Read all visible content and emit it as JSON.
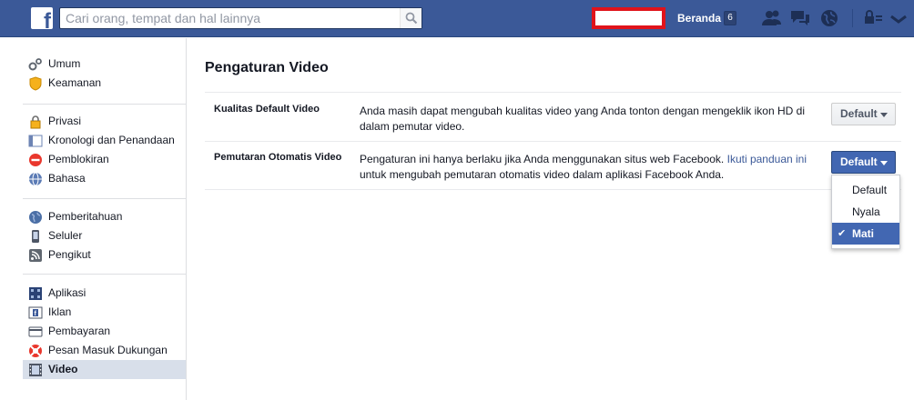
{
  "topbar": {
    "logo": "f",
    "search_placeholder": "Cari orang, tempat dan hal lainnya",
    "home_label": "Beranda",
    "home_count": "6"
  },
  "sidebar": {
    "groups": [
      [
        {
          "label": "Umum",
          "icon": "gears-icon"
        },
        {
          "label": "Keamanan",
          "icon": "shield-icon"
        }
      ],
      [
        {
          "label": "Privasi",
          "icon": "lock-icon"
        },
        {
          "label": "Kronologi dan Penandaan",
          "icon": "timeline-icon"
        },
        {
          "label": "Pemblokiran",
          "icon": "block-icon"
        },
        {
          "label": "Bahasa",
          "icon": "globe-icon"
        }
      ],
      [
        {
          "label": "Pemberitahuan",
          "icon": "globe-icon"
        },
        {
          "label": "Seluler",
          "icon": "phone-icon"
        },
        {
          "label": "Pengikut",
          "icon": "rss-icon"
        }
      ],
      [
        {
          "label": "Aplikasi",
          "icon": "apps-icon"
        },
        {
          "label": "Iklan",
          "icon": "ads-icon"
        },
        {
          "label": "Pembayaran",
          "icon": "card-icon"
        },
        {
          "label": "Pesan Masuk Dukungan",
          "icon": "lifebuoy-icon"
        },
        {
          "label": "Video",
          "icon": "film-icon",
          "active": true
        }
      ]
    ]
  },
  "main": {
    "title": "Pengaturan Video",
    "rows": [
      {
        "label": "Kualitas Default Video",
        "desc": "Anda masih dapat mengubah kualitas video yang Anda tonton dengan mengeklik ikon HD di dalam pemutar video.",
        "button": "Default"
      },
      {
        "label": "Pemutaran Otomatis Video",
        "desc_before": "Pengaturan ini hanya berlaku jika Anda menggunakan situs web Facebook. ",
        "desc_link": "Ikuti panduan ini",
        "desc_after": " untuk mengubah pemutaran otomatis video dalam aplikasi Facebook Anda.",
        "button": "Default"
      }
    ],
    "dropdown": {
      "options": [
        "Default",
        "Nyala",
        "Mati"
      ],
      "selected": "Mati"
    }
  },
  "colors": {
    "brand": "#3b5998",
    "accent": "#4267b2",
    "highlight": "#e0131b"
  }
}
